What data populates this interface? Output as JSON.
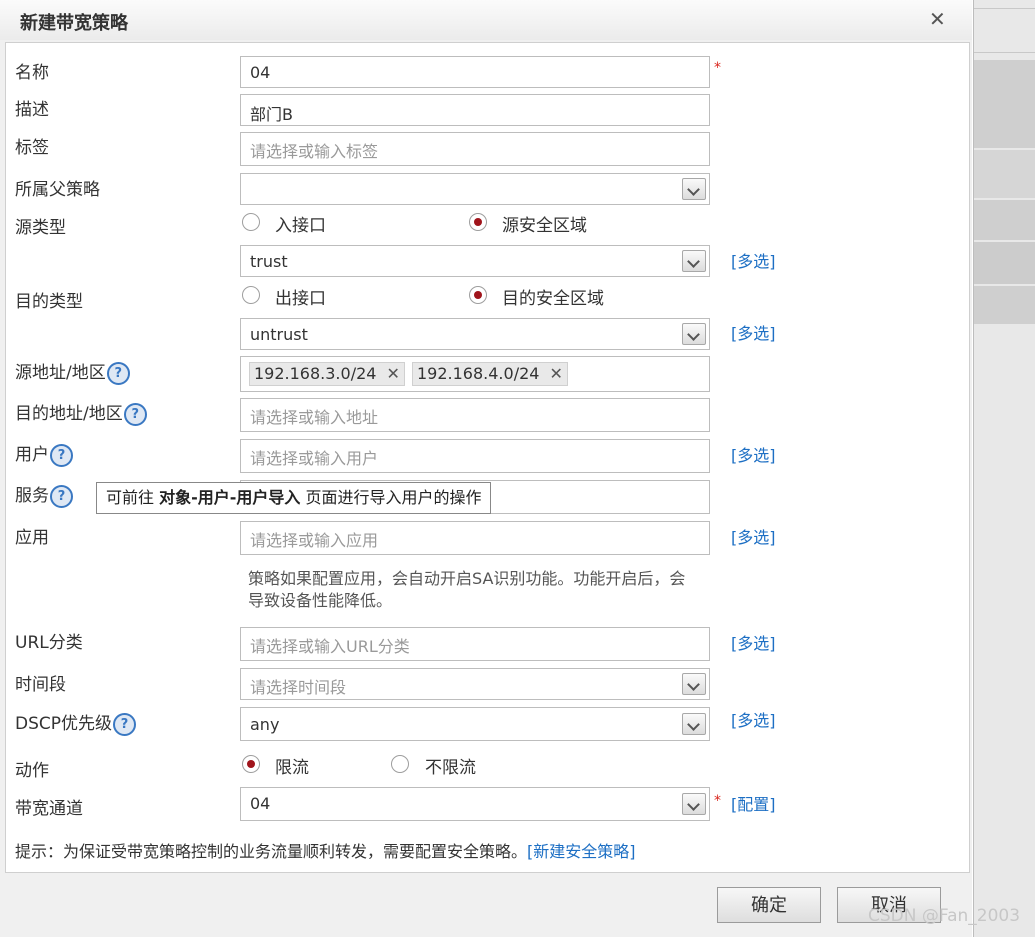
{
  "dialog": {
    "title": "新建带宽策略"
  },
  "fields": {
    "name": {
      "label": "名称",
      "value": "04"
    },
    "description": {
      "label": "描述",
      "value": "部门B"
    },
    "tag": {
      "label": "标签",
      "placeholder": "请选择或输入标签"
    },
    "parent_policy": {
      "label": "所属父策略",
      "value": ""
    },
    "source_type": {
      "label": "源类型",
      "options": [
        "入接口",
        "源安全区域"
      ],
      "selected": "源安全区域",
      "zone_value": "trust",
      "multi_link": "[多选]"
    },
    "dest_type": {
      "label": "目的类型",
      "options": [
        "出接口",
        "目的安全区域"
      ],
      "selected": "目的安全区域",
      "zone_value": "untrust",
      "multi_link": "[多选]"
    },
    "source_address": {
      "label": "源地址/地区",
      "tags": [
        "192.168.3.0/24",
        "192.168.4.0/24"
      ]
    },
    "dest_address": {
      "label": "目的地址/地区",
      "placeholder": "请选择或输入地址"
    },
    "user": {
      "label": "用户",
      "placeholder": "请选择或输入用户",
      "multi_link": "[多选]"
    },
    "service": {
      "label": "服务",
      "tooltip_pre": "可前往 ",
      "tooltip_bold": "对象-用户-用户导入",
      "tooltip_post": " 页面进行导入用户的操作"
    },
    "application": {
      "label": "应用",
      "placeholder": "请选择或输入应用",
      "multi_link": "[多选]",
      "note": "策略如果配置应用，会自动开启SA识别功能。功能开启后，会导致设备性能降低。"
    },
    "url_category": {
      "label": "URL分类",
      "placeholder": "请选择或输入URL分类",
      "multi_link": "[多选]"
    },
    "time_range": {
      "label": "时间段",
      "placeholder": "请选择时间段"
    },
    "dscp": {
      "label": "DSCP优先级",
      "value": "any",
      "multi_link": "[多选]"
    },
    "action": {
      "label": "动作",
      "options": [
        "限流",
        "不限流"
      ],
      "selected": "限流"
    },
    "bandwidth_channel": {
      "label": "带宽通道",
      "value": "04",
      "config_link": "[配置]"
    }
  },
  "hint": {
    "text": "提示：为保证受带宽策略控制的业务流量顺利转发，需要配置安全策略。",
    "link": "[新建安全策略]"
  },
  "buttons": {
    "ok": "确定",
    "cancel": "取消"
  },
  "help_icon": "?",
  "watermark": "CSDN @Fan_2003"
}
